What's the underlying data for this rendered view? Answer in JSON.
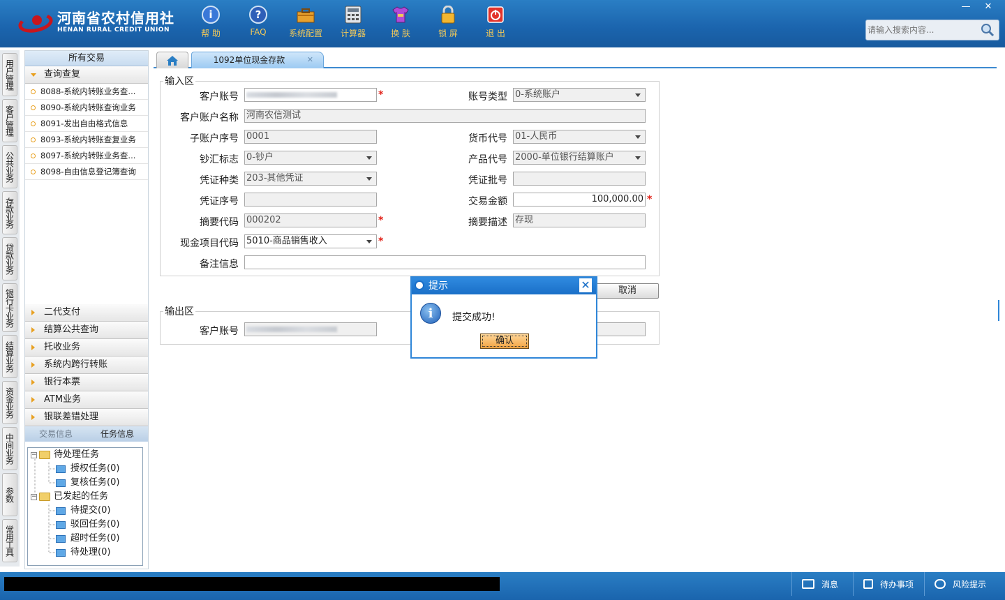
{
  "header": {
    "logo_cn": "河南省农村信用社",
    "logo_en": "HENAN RURAL CREDIT UNION",
    "tools": [
      {
        "label": "帮 助",
        "icon": "help-icon"
      },
      {
        "label": "FAQ",
        "icon": "faq-icon"
      },
      {
        "label": "系统配置",
        "icon": "toolbox-icon"
      },
      {
        "label": "计算器",
        "icon": "calculator-icon"
      },
      {
        "label": "换 肤",
        "icon": "shirt-icon"
      },
      {
        "label": "锁 屏",
        "icon": "lock-icon"
      },
      {
        "label": "退 出",
        "icon": "power-icon"
      }
    ],
    "search_placeholder": "请输入搜索内容...",
    "win_min": "—",
    "win_close": "✕"
  },
  "vnav": [
    "用户管理",
    "客户管理",
    "公共业务",
    "存款业务",
    "贷款业务",
    "银行卡业务",
    "结算业务",
    "资金业务",
    "中间业务",
    "参数",
    "常用工具"
  ],
  "sidebar": {
    "head": "所有交易",
    "open_group": "查询查复",
    "items": [
      "8088-系统内转账业务查...",
      "8090-系统内转账查询业务",
      "8091-发出自由格式信息",
      "8093-系统内转账查复业务",
      "8097-系统内转账业务查...",
      "8098-自由信息登记簿查询"
    ],
    "groups": [
      "二代支付",
      "结算公共查询",
      "托收业务",
      "系统内跨行转账",
      "银行本票",
      "ATM业务",
      "银联差错处理"
    ],
    "bottom_tabs": [
      "交易信息",
      "任务信息"
    ],
    "tree": {
      "pending": "待处理任务",
      "pending_children": [
        "授权任务(0)",
        "复核任务(0)"
      ],
      "launched": "已发起的任务",
      "launched_children": [
        "待提交(0)",
        "驳回任务(0)",
        "超时任务(0)",
        "待处理(0)"
      ]
    }
  },
  "main": {
    "tab_title": "1092单位现金存款",
    "input_legend": "输入区",
    "output_legend": "输出区",
    "fields": {
      "cust_account_label": "客户账号",
      "acct_type_label": "账号类型",
      "acct_type_value": "0-系统账户",
      "cust_name_label": "客户账户名称",
      "cust_name_value": "河南农信测试",
      "sub_acct_label": "子账户序号",
      "sub_acct_value": "0001",
      "currency_label": "货币代号",
      "currency_value": "01-人民币",
      "cash_flag_label": "钞汇标志",
      "cash_flag_value": "0-钞户",
      "product_label": "产品代号",
      "product_value": "2000-单位银行结算账户",
      "voucher_type_label": "凭证种类",
      "voucher_type_value": "203-其他凭证",
      "voucher_batch_label": "凭证批号",
      "voucher_seq_label": "凭证序号",
      "amount_label": "交易金额",
      "amount_value": "100,000.00",
      "summary_code_label": "摘要代码",
      "summary_code_value": "000202",
      "summary_desc_label": "摘要描述",
      "summary_desc_value": "存现",
      "cash_item_label": "现金项目代码",
      "cash_item_value": "5010-商品销售收入",
      "remark_label": "备注信息",
      "out_account_label": "客户账号"
    },
    "cancel_button": "取消",
    "required_mark": "*"
  },
  "dialog": {
    "title": "提示",
    "message": "提交成功!",
    "ok": "确认",
    "close": "✕"
  },
  "statusbar": {
    "messages": "消息",
    "todo": "待办事项",
    "risk": "风险提示"
  },
  "colors": {
    "header_blue": "#1b64ad",
    "accent_orange": "#f2a341",
    "required_red": "#e2231a"
  }
}
